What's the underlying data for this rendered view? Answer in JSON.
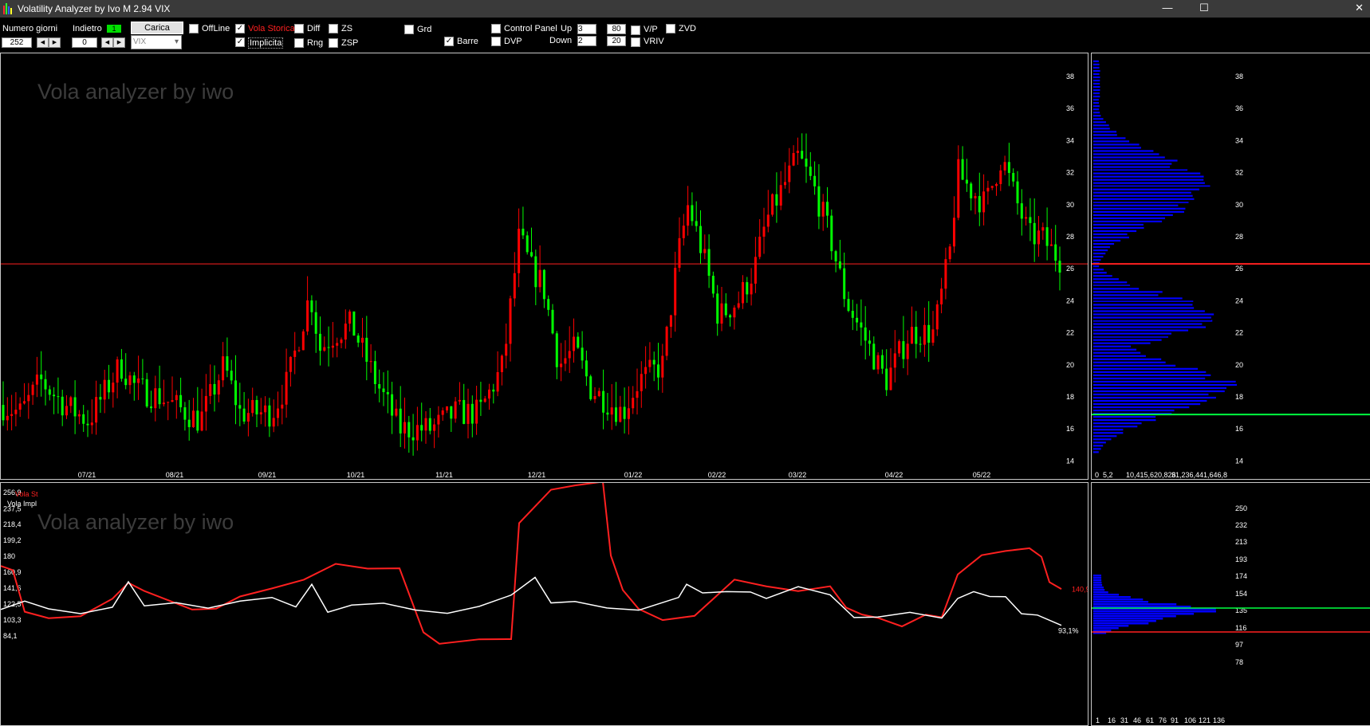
{
  "window": {
    "title": "Volatility Analyzer by Ivo M 2.94  VIX",
    "minimize": "—",
    "maximize": "☐",
    "close": "✕"
  },
  "toolbar": {
    "numero_giorni_label": "Numero giorni",
    "numero_giorni_value": "252",
    "indietro_label": "Indietro",
    "indietro_value": "0",
    "indicator_value": "1",
    "carica_label": "Carica",
    "symbol_value": "VIX",
    "offline_label": "OffLine",
    "vola_storica_label": "Vola Storica",
    "implicita_label": "Implicita",
    "diff_label": "Diff",
    "rng_label": "Rng",
    "zs_label": "ZS",
    "zsp_label": "ZSP",
    "grd_label": "Grd",
    "barre_label": "Barre",
    "control_panel_label": "Control Panel",
    "dvp_label": "DVP",
    "up_label": "Up",
    "up_value": "3",
    "down_label": "Down",
    "down_value": "2",
    "up_pct": "80",
    "down_pct": "20",
    "vp_label": "V/P",
    "zvd_label": "ZVD",
    "vriv_label": "VRIV",
    "checked": {
      "offline": false,
      "vola_storica": true,
      "implicita": true,
      "diff": false,
      "rng": false,
      "zs": false,
      "zsp": false,
      "grd": false,
      "barre": true,
      "control_panel": false,
      "dvp": false,
      "vp": false,
      "zvd": false,
      "vriv": false
    }
  },
  "main_chart": {
    "watermark": "Vola analyzer by iwo",
    "y_ticks": [
      "38",
      "36",
      "34",
      "32",
      "30",
      "28",
      "26",
      "24",
      "22",
      "20",
      "18",
      "16",
      "14"
    ],
    "x_ticks": [
      "07/21",
      "08/21",
      "09/21",
      "10/21",
      "11/21",
      "12/21",
      "01/22",
      "02/22",
      "03/22",
      "04/22",
      "05/22"
    ],
    "current_level_line": 26.3,
    "colors": {
      "up": "#00ff00",
      "down": "#ff0000",
      "line": "#ff2020"
    }
  },
  "profile_chart": {
    "y_ticks": [
      "38",
      "36",
      "34",
      "32",
      "30",
      "28",
      "26",
      "24",
      "22",
      "20",
      "18",
      "16",
      "14"
    ],
    "x_labels": [
      "0",
      "5,2",
      "10,415,620,826",
      "31,236,441,646,8"
    ],
    "red_line_level": 26.3,
    "green_line_level": 16.9,
    "bar_color": "#0000ff"
  },
  "lower_chart": {
    "watermark": "Vola analyzer by iwo",
    "legend_red": "Vola St",
    "legend_white": "Vola Impl",
    "y_ticks": [
      "256,9",
      "237,5",
      "218,4",
      "199,2",
      "180",
      "160,9",
      "141,6",
      "122,5",
      "103,3",
      "84,1"
    ],
    "last_red_label": "140,9",
    "last_white_label": "93,1%",
    "colors": {
      "historical": "#ff2020",
      "implied": "#ffffff"
    }
  },
  "lower_profile": {
    "y_ticks": [
      "250",
      "232",
      "213",
      "193",
      "174",
      "154",
      "135",
      "116",
      "97",
      "78"
    ],
    "x_labels": [
      "1",
      "16",
      "31",
      "46",
      "61",
      "76",
      "91",
      "106",
      "121",
      "136"
    ]
  }
}
